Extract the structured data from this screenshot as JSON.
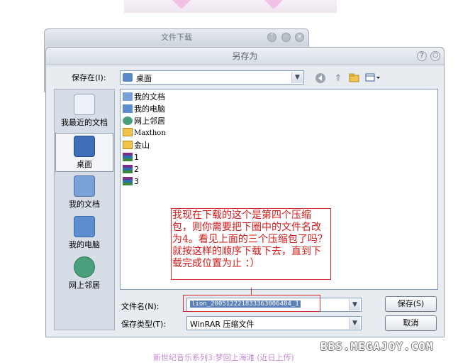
{
  "background_dialog": {
    "title": "文件下载"
  },
  "dialog": {
    "title": "另存为",
    "save_in_label": "保存在(I):",
    "save_in_value": "桌面",
    "places": [
      {
        "label": "我最近的文档",
        "icon": "recent-documents-icon",
        "selected": false
      },
      {
        "label": "桌面",
        "icon": "desktop-icon",
        "selected": true
      },
      {
        "label": "我的文档",
        "icon": "my-documents-icon",
        "selected": false
      },
      {
        "label": "我的电脑",
        "icon": "my-computer-icon",
        "selected": false
      },
      {
        "label": "网上邻居",
        "icon": "network-places-icon",
        "selected": false
      }
    ],
    "files": [
      {
        "name": "我的文档",
        "icon": "my-documents-icon"
      },
      {
        "name": "我的电脑",
        "icon": "my-computer-icon"
      },
      {
        "name": "网上邻居",
        "icon": "network-places-icon"
      },
      {
        "name": "Maxthon",
        "icon": "folder-icon"
      },
      {
        "name": "金山",
        "icon": "folder-icon"
      },
      {
        "name": "1",
        "icon": "winrar-archive-icon"
      },
      {
        "name": "2",
        "icon": "winrar-archive-icon"
      },
      {
        "name": "3",
        "icon": "winrar-archive-icon"
      }
    ],
    "filename_label": "文件名(N):",
    "filename_value": "lion_20051222183336300640​4_1",
    "filetype_label": "保存类型(T):",
    "filetype_value": "WinRAR 压缩文件",
    "save_button": "保存(S)",
    "cancel_button": "取消"
  },
  "annotation": "我现在下载的这个是第四个压缩包，则你需要把下圈中的文件名改为4。看见上面的三个压缩包了吗？就按这样的顺序下载下去，直到下载完成位置为止 ：）",
  "watermark": "BBS.MEGAJOY.COM",
  "footer": "新世纪音乐系列3:梦回上海滩 (近日上传)"
}
